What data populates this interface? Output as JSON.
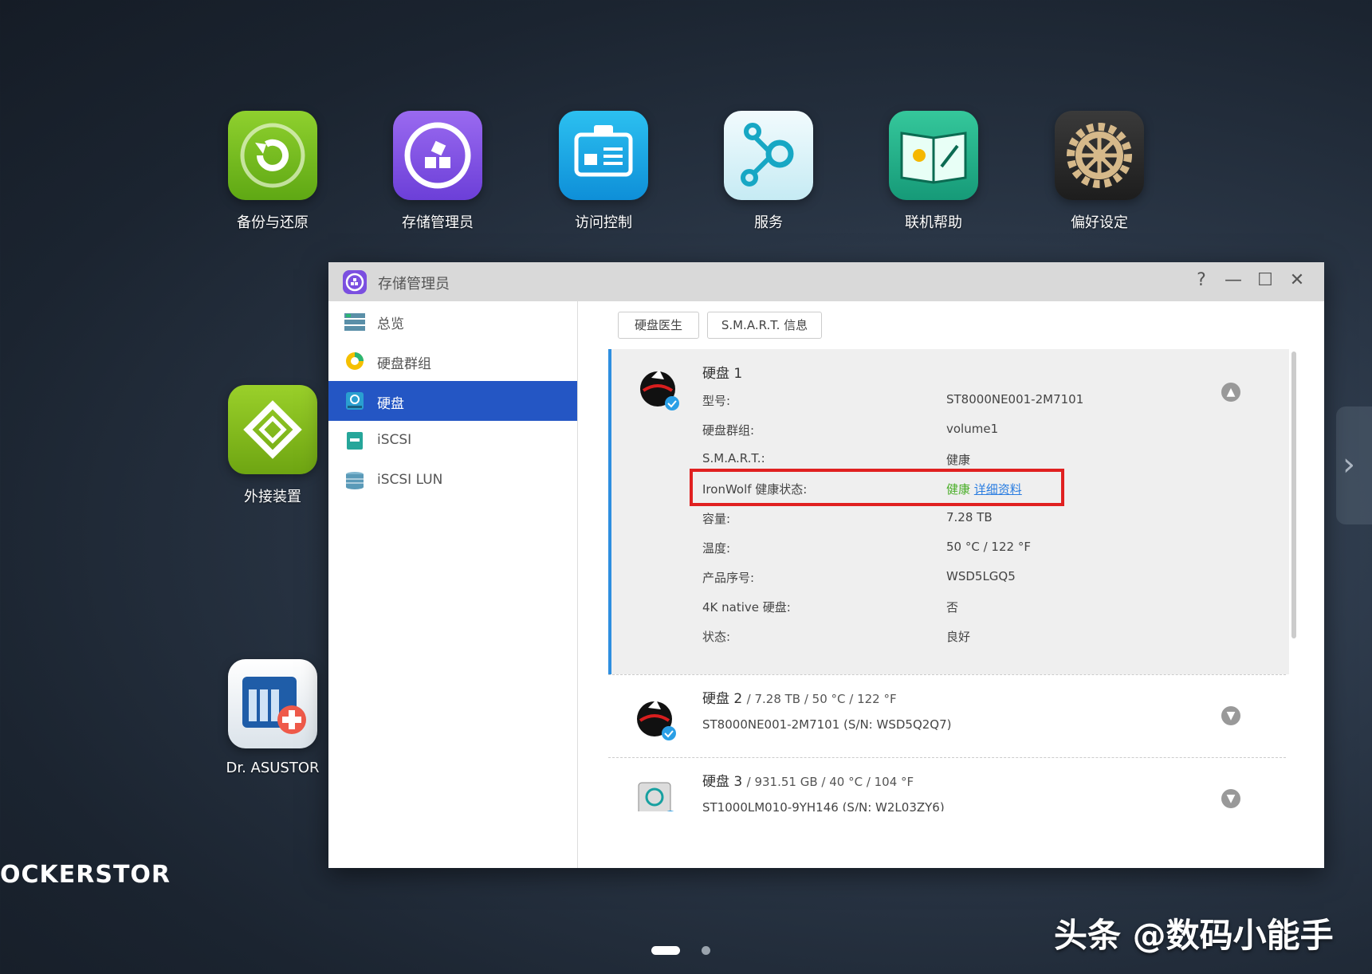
{
  "desktop": {
    "icons": [
      {
        "label": "备份与还原",
        "icon": "backup-icon",
        "color": "#7cc021"
      },
      {
        "label": "存储管理员",
        "icon": "storage-manager-icon",
        "color": "#8a55e8"
      },
      {
        "label": "访问控制",
        "icon": "access-control-icon",
        "color": "#1aa8e6"
      },
      {
        "label": "服务",
        "icon": "services-icon",
        "color": "#d8f1f8"
      },
      {
        "label": "联机帮助",
        "icon": "online-help-icon",
        "color": "#23b08a"
      },
      {
        "label": "偏好设定",
        "icon": "preferences-icon",
        "color": "#2b2b2b"
      },
      {
        "label": "外接装置",
        "icon": "external-devices-icon",
        "color": "#8dc020"
      },
      {
        "label": "Dr. ASUSTOR",
        "icon": "dr-asustor-icon",
        "color": "#e8eef4"
      }
    ],
    "brand": "OCKERSTOR",
    "watermark": "头条 @数码小能手"
  },
  "window": {
    "title": "存储管理员",
    "controls": {
      "help": "?",
      "minimize": "—",
      "maximize": "☐",
      "close": "✕"
    },
    "sidebar": [
      {
        "label": "总览",
        "icon": "overview-icon"
      },
      {
        "label": "硬盘群组",
        "icon": "volume-icon"
      },
      {
        "label": "硬盘",
        "icon": "disk-icon",
        "active": true
      },
      {
        "label": "iSCSI",
        "icon": "iscsi-icon"
      },
      {
        "label": "iSCSI LUN",
        "icon": "iscsi-lun-icon"
      }
    ],
    "tabs": [
      "硬盘医生",
      "S.M.A.R.T. 信息"
    ],
    "disk1": {
      "name": "硬盘 1",
      "fields": [
        {
          "label": "型号:",
          "value": "ST8000NE001-2M7101"
        },
        {
          "label": "硬盘群组:",
          "value": "volume1"
        },
        {
          "label": "S.M.A.R.T.:",
          "value": "健康"
        },
        {
          "label": "IronWolf 健康状态:",
          "value": "健康",
          "link": "详细资料"
        },
        {
          "label": "容量:",
          "value": "7.28 TB"
        },
        {
          "label": "温度:",
          "value": "50 °C / 122 °F"
        },
        {
          "label": "产品序号:",
          "value": "WSD5LGQ5"
        },
        {
          "label": "4K native 硬盘:",
          "value": "否"
        },
        {
          "label": "状态:",
          "value": "良好"
        }
      ]
    },
    "disk2": {
      "name": "硬盘 2",
      "summary": "/ 7.28 TB / 50 °C / 122 °F",
      "model": "ST8000NE001-2M7101 (S/N: WSD5Q2Q7)"
    },
    "disk3": {
      "name": "硬盘 3",
      "summary": "/ 931.51 GB / 40 °C / 104 °F",
      "model": "ST1000LM010-9YH146 (S/N: W2L03ZY6)"
    }
  }
}
